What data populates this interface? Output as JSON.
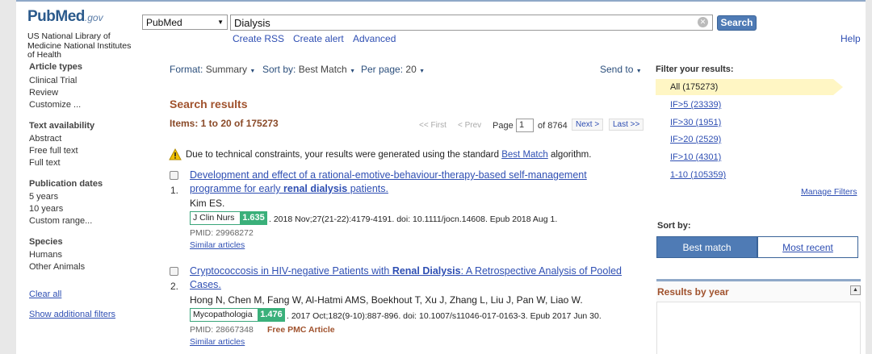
{
  "header": {
    "logo_pub": "Pub",
    "logo_med": "Med",
    "logo_gov": ".gov",
    "logo_subtitle": "US National Library of Medicine National Institutes of Health",
    "database": "PubMed",
    "query": "Dialysis",
    "search_label": "Search",
    "links": {
      "rss": "Create RSS",
      "alert": "Create alert",
      "advanced": "Advanced"
    },
    "help": "Help"
  },
  "sidebar": {
    "groups": [
      {
        "heading": "Article types",
        "items": [
          "Clinical Trial",
          "Review",
          "Customize ..."
        ]
      },
      {
        "heading": "Text availability",
        "items": [
          "Abstract",
          "Free full text",
          "Full text"
        ]
      },
      {
        "heading": "Publication dates",
        "items": [
          "5 years",
          "10 years",
          "Custom range..."
        ]
      },
      {
        "heading": "Species",
        "items": [
          "Humans",
          "Other Animals"
        ]
      }
    ],
    "clear_all": "Clear all",
    "show_filters": "Show additional filters"
  },
  "toolbar": {
    "format_label": "Format:",
    "format_value": "Summary",
    "sort_label": "Sort by:",
    "sort_value": "Best Match",
    "perpage_label": "Per page:",
    "perpage_value": "20",
    "send_to": "Send to"
  },
  "results": {
    "title": "Search results",
    "items": "Items: 1 to 20 of 175273",
    "pager": {
      "first": "<< First",
      "prev": "< Prev",
      "page_label": "Page",
      "page": "1",
      "of": "of 8764",
      "next": "Next >",
      "last": "Last >>"
    },
    "warning_pre": "Due to technical constraints, your results were generated using the standard",
    "warning_link": "Best Match",
    "warning_post": "algorithm.",
    "articles": [
      {
        "num": "1.",
        "title_line1": "Development and effect of a rational-emotive-behaviour-therapy-based self-management",
        "title_line2_pre": "programme for early ",
        "title_line2_bold": "renal dialysis",
        "title_line2_post": " patients.",
        "authors": "Kim ES.",
        "journal": "J Clin Nurs",
        "impact": "1.635",
        "citation": ". 2018 Nov;27(21-22):4179-4191. doi: 10.1111/jocn.14608. Epub 2018 Aug 1.",
        "pmid": "PMID: 29968272",
        "similar": "Similar articles"
      },
      {
        "num": "2.",
        "title_line1_pre": "Cryptococcosis in HIV-negative Patients with ",
        "title_line1_bold": "Renal Dialysis",
        "title_line1_post": ": A Retrospective Analysis of Pooled",
        "title_line2": "Cases.",
        "authors": "Hong N, Chen M, Fang W, Al-Hatmi AMS, Boekhout T, Xu J, Zhang L, Liu J, Pan W, Liao W.",
        "journal": "Mycopathologia",
        "impact": "1.476",
        "citation": ". 2017 Oct;182(9-10):887-896. doi: 10.1007/s11046-017-0163-3. Epub 2017 Jun 30.",
        "pmid": "PMID: 28667348",
        "free": "Free PMC Article",
        "similar": "Similar articles"
      }
    ]
  },
  "filters": {
    "title": "Filter your results:",
    "all": "All (175273)",
    "items": [
      "IF>5 (23339)",
      "IF>30 (1951)",
      "IF>20 (2529)",
      "IF>10 (4301)",
      "1-10 (105359)"
    ],
    "manage": "Manage Filters",
    "sort_label": "Sort by:",
    "best_match": "Best match",
    "most_recent": "Most recent",
    "results_by_year": "Results by year"
  },
  "colors": {
    "accent": "#4f7bb5",
    "badge": "#3ab07a",
    "heading": "#a0522d",
    "link": "#2f4fb3"
  }
}
